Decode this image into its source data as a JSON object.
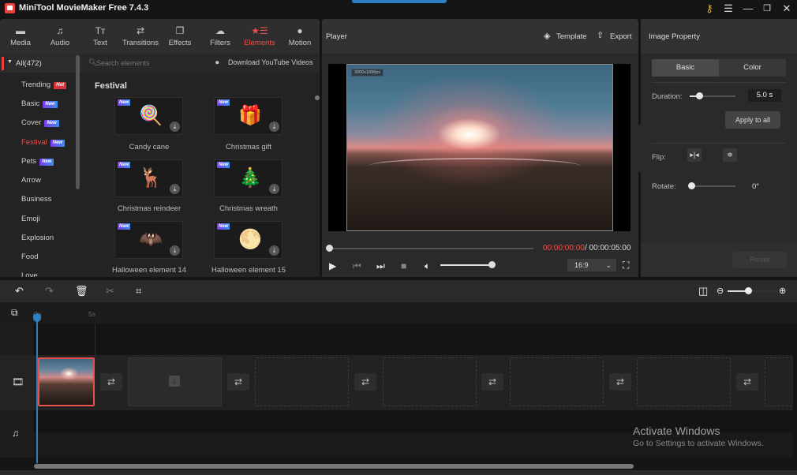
{
  "app": {
    "title": "MiniTool MovieMaker Free 7.4.3"
  },
  "window_controls": {
    "key": "key-icon",
    "menu": "menu-icon",
    "minimize": "minimize-icon",
    "restore": "restore-icon",
    "close": "close-icon"
  },
  "tabs": [
    {
      "label": "Media",
      "icon": "folder-icon",
      "glyph": "▬"
    },
    {
      "label": "Audio",
      "icon": "music-icon",
      "glyph": "♫"
    },
    {
      "label": "Text",
      "icon": "text-icon",
      "glyph": "Tт"
    },
    {
      "label": "Transitions",
      "icon": "transitions-icon",
      "glyph": "⇄"
    },
    {
      "label": "Effects",
      "icon": "effects-icon",
      "glyph": "❐"
    },
    {
      "label": "Filters",
      "icon": "filters-icon",
      "glyph": "☁"
    },
    {
      "label": "Elements",
      "icon": "elements-icon",
      "glyph": "★☰",
      "active": true
    },
    {
      "label": "Motion",
      "icon": "motion-icon",
      "glyph": "●"
    }
  ],
  "categories": {
    "all_label": "All(472)",
    "items": [
      {
        "label": "Trending",
        "badge": "Hot"
      },
      {
        "label": "Basic",
        "badge": "New"
      },
      {
        "label": "Cover",
        "badge": "New"
      },
      {
        "label": "Festival",
        "badge": "New",
        "active": true
      },
      {
        "label": "Pets",
        "badge": "New"
      },
      {
        "label": "Arrow"
      },
      {
        "label": "Business"
      },
      {
        "label": "Emoji"
      },
      {
        "label": "Explosion"
      },
      {
        "label": "Food"
      },
      {
        "label": "Love"
      }
    ]
  },
  "elements": {
    "search_placeholder": "Search elements",
    "download_youtube": "Download YouTube Videos",
    "section_title": "Festival",
    "new_badge": "New",
    "items": [
      {
        "label": "Candy cane",
        "art": "🍭"
      },
      {
        "label": "Christmas gift",
        "art": "🎁"
      },
      {
        "label": "Christmas reindeer",
        "art": "🦌"
      },
      {
        "label": "Christmas wreath",
        "art": "🎄"
      },
      {
        "label": "Halloween element 14",
        "art": "🦇"
      },
      {
        "label": "Halloween element 15",
        "art": "🌕"
      }
    ]
  },
  "player": {
    "title": "Player",
    "template_label": "Template",
    "export_label": "Export",
    "resolution_label": "3000x1898px",
    "current_time": "00:00:00:00",
    "total_time": "/ 00:00:05:00",
    "seek_progress": 0,
    "volume": 1.0,
    "aspect_ratio": "16:9"
  },
  "property": {
    "title": "Image Property",
    "tab_basic": "Basic",
    "tab_color": "Color",
    "duration_label": "Duration:",
    "duration_value": "5.0 s",
    "apply_all": "Apply to all",
    "flip_label": "Flip:",
    "rotate_label": "Rotate:",
    "rotate_value": "0°",
    "reset": "Reset"
  },
  "timeline": {
    "ruler": [
      "0s",
      "5s"
    ],
    "zoom_level": 0.6
  },
  "watermark": {
    "title": "Activate Windows",
    "subtitle": "Go to Settings to activate Windows."
  }
}
